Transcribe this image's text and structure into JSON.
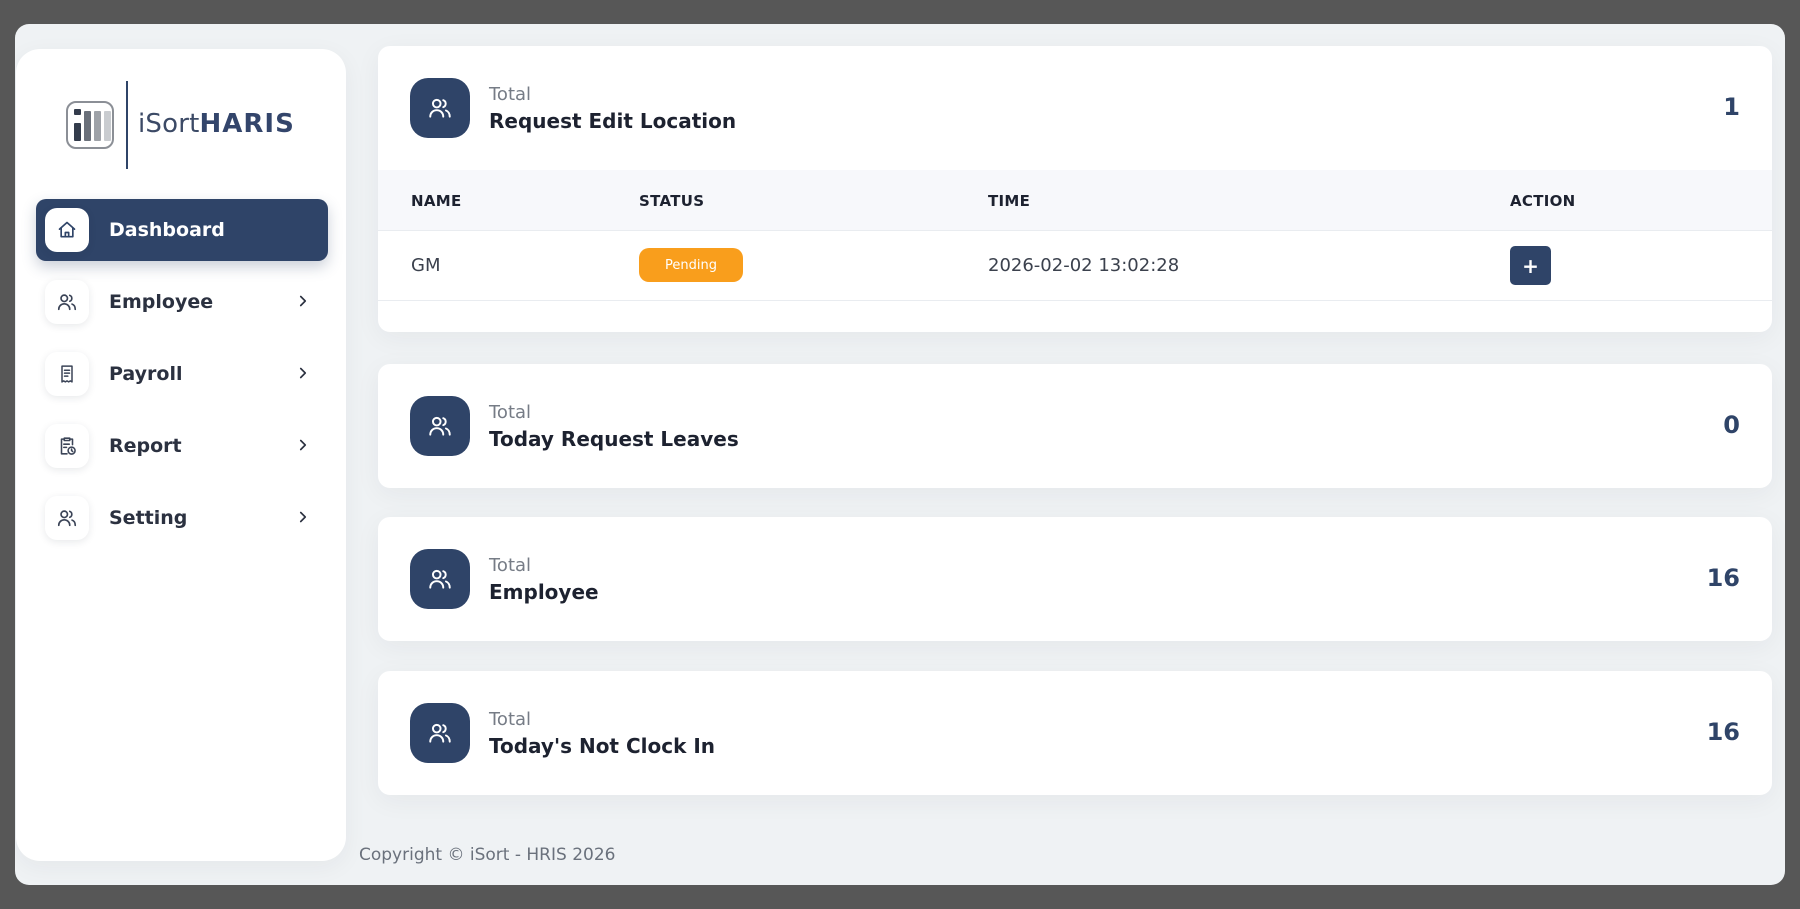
{
  "brand": {
    "prefix": "iSort",
    "suffix": "HARIS"
  },
  "colors": {
    "primary": "#2f4468",
    "pending": "#f99e1c",
    "background": "#eff2f4"
  },
  "sidebar": {
    "items": [
      {
        "label": "Dashboard",
        "icon": "home-icon",
        "active": true
      },
      {
        "label": "Employee",
        "icon": "users-icon",
        "active": false
      },
      {
        "label": "Payroll",
        "icon": "receipt-icon",
        "active": false
      },
      {
        "label": "Report",
        "icon": "clipboard-clock-icon",
        "active": false
      },
      {
        "label": "Setting",
        "icon": "users-icon",
        "active": false
      }
    ]
  },
  "cards": [
    {
      "pre": "Total",
      "title": "Request Edit Location",
      "count": "1",
      "icon": "users-icon",
      "table": {
        "headers": [
          "NAME",
          "STATUS",
          "TIME",
          "ACTION"
        ],
        "rows": [
          {
            "name": "GM",
            "status": "Pending",
            "time": "2026-02-02 13:02:28",
            "action": "+"
          }
        ]
      }
    },
    {
      "pre": "Total",
      "title": "Today Request Leaves",
      "count": "0",
      "icon": "users-icon"
    },
    {
      "pre": "Total",
      "title": "Employee",
      "count": "16",
      "icon": "users-icon"
    },
    {
      "pre": "Total",
      "title": "Today's Not Clock In",
      "count": "16",
      "icon": "users-icon"
    }
  ],
  "footer": {
    "text": "Copyright © iSort - HRIS 2026"
  }
}
